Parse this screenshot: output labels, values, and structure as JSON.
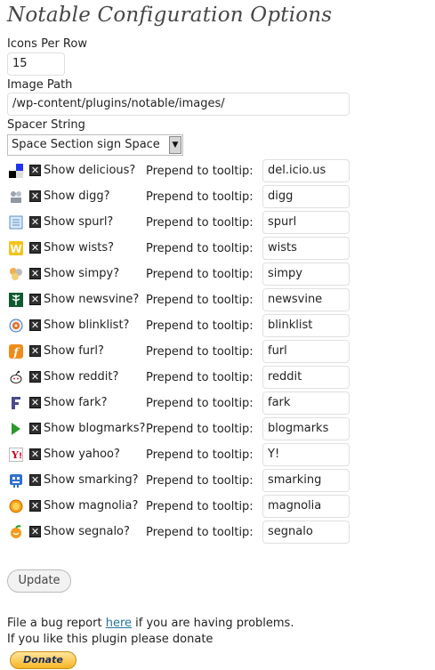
{
  "page": {
    "title": "Notable Configuration Options"
  },
  "icons_per_row": {
    "label": "Icons Per Row",
    "value": "15"
  },
  "image_path": {
    "label": "Image Path",
    "value": "/wp-content/plugins/notable/images/"
  },
  "spacer_string": {
    "label": "Spacer String",
    "value": "Space Section sign Space"
  },
  "prepend_label": "Prepend to tooltip:",
  "sites": [
    {
      "icon": "delicious-icon",
      "show_label": "Show delicious?",
      "tooltip": "del.icio.us"
    },
    {
      "icon": "digg-icon",
      "show_label": "Show digg?",
      "tooltip": "digg"
    },
    {
      "icon": "spurl-icon",
      "show_label": "Show spurl?",
      "tooltip": "spurl"
    },
    {
      "icon": "wists-icon",
      "show_label": "Show wists?",
      "tooltip": "wists"
    },
    {
      "icon": "simpy-icon",
      "show_label": "Show simpy?",
      "tooltip": "simpy"
    },
    {
      "icon": "newsvine-icon",
      "show_label": "Show newsvine?",
      "tooltip": "newsvine"
    },
    {
      "icon": "blinklist-icon",
      "show_label": "Show blinklist?",
      "tooltip": "blinklist"
    },
    {
      "icon": "furl-icon",
      "show_label": "Show furl?",
      "tooltip": "furl"
    },
    {
      "icon": "reddit-icon",
      "show_label": "Show reddit?",
      "tooltip": "reddit"
    },
    {
      "icon": "fark-icon",
      "show_label": "Show fark?",
      "tooltip": "fark"
    },
    {
      "icon": "blogmarks-icon",
      "show_label": "Show blogmarks?",
      "tooltip": "blogmarks"
    },
    {
      "icon": "yahoo-icon",
      "show_label": "Show yahoo?",
      "tooltip": "Y!"
    },
    {
      "icon": "smarking-icon",
      "show_label": "Show smarking?",
      "tooltip": "smarking"
    },
    {
      "icon": "magnolia-icon",
      "show_label": "Show magnolia?",
      "tooltip": "magnolia"
    },
    {
      "icon": "segnalo-icon",
      "show_label": "Show segnalo?",
      "tooltip": "segnalo"
    }
  ],
  "update_button": "Update",
  "footer": {
    "bug_prefix": "File a bug report ",
    "bug_link": "here",
    "bug_suffix": " if you are having problems.",
    "donate_text": "If you like this plugin please donate",
    "donate_button": "Donate"
  }
}
